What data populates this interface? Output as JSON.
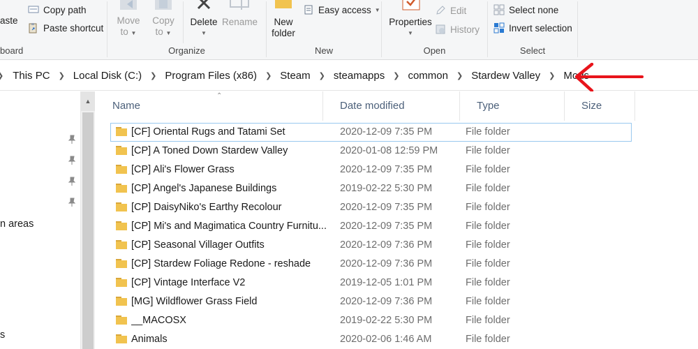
{
  "ribbon": {
    "clipboard": {
      "paste_label": "aste",
      "copy_path_label": "Copy path",
      "paste_shortcut_label": "Paste shortcut",
      "group_label": "board"
    },
    "organize": {
      "move_to_line1": "Move",
      "move_to_line2": "to",
      "copy_to_line1": "Copy",
      "copy_to_line2": "to",
      "delete_label": "Delete",
      "rename_label": "Rename",
      "group_label": "Organize"
    },
    "new": {
      "new_folder_line1": "New",
      "new_folder_line2": "folder",
      "easy_access_label": "Easy access",
      "group_label": "New"
    },
    "open": {
      "properties_label": "Properties",
      "edit_label": "Edit",
      "history_label": "History",
      "group_label": "Open"
    },
    "select": {
      "select_none_label": "Select none",
      "invert_selection_label": "Invert selection",
      "group_label": "Select"
    }
  },
  "address": {
    "crumbs": [
      "This PC",
      "Local Disk (C:)",
      "Program Files (x86)",
      "Steam",
      "steamapps",
      "common",
      "Stardew Valley",
      "Mods"
    ]
  },
  "annotation": {
    "arrow_color": "#e8141b"
  },
  "nav": {
    "partial_item_1": "n areas",
    "partial_item_2": "s"
  },
  "columns": {
    "name": "Name",
    "date": "Date modified",
    "type": "Type",
    "size": "Size"
  },
  "files": [
    {
      "name": "[CF] Oriental Rugs and Tatami Set",
      "date": "2020-12-09 7:35 PM",
      "type": "File folder"
    },
    {
      "name": "[CP] A Toned Down Stardew Valley",
      "date": "2020-01-08 12:59 PM",
      "type": "File folder"
    },
    {
      "name": "[CP] Ali's Flower Grass",
      "date": "2020-12-09 7:35 PM",
      "type": "File folder"
    },
    {
      "name": "[CP] Angel's Japanese Buildings",
      "date": "2019-02-22 5:30 PM",
      "type": "File folder"
    },
    {
      "name": "[CP] DaisyNiko's Earthy Recolour",
      "date": "2020-12-09 7:35 PM",
      "type": "File folder"
    },
    {
      "name": "[CP] Mi's and Magimatica Country Furnitu...",
      "date": "2020-12-09 7:35 PM",
      "type": "File folder"
    },
    {
      "name": "[CP] Seasonal Villager Outfits",
      "date": "2020-12-09 7:36 PM",
      "type": "File folder"
    },
    {
      "name": "[CP] Stardew Foliage Redone - reshade",
      "date": "2020-12-09 7:36 PM",
      "type": "File folder"
    },
    {
      "name": "[CP] Vintage Interface V2",
      "date": "2019-12-05 1:01 PM",
      "type": "File folder"
    },
    {
      "name": "[MG] Wildflower Grass Field",
      "date": "2020-12-09 7:36 PM",
      "type": "File folder"
    },
    {
      "name": "__MACOSX",
      "date": "2019-02-22 5:30 PM",
      "type": "File folder"
    },
    {
      "name": "Animals",
      "date": "2020-02-06 1:46 AM",
      "type": "File folder"
    }
  ],
  "colors": {
    "folder": "#f1c34f",
    "folder_dark": "#d9a73a",
    "header_text": "#4c607a",
    "focus_outline": "#99c9ef"
  }
}
